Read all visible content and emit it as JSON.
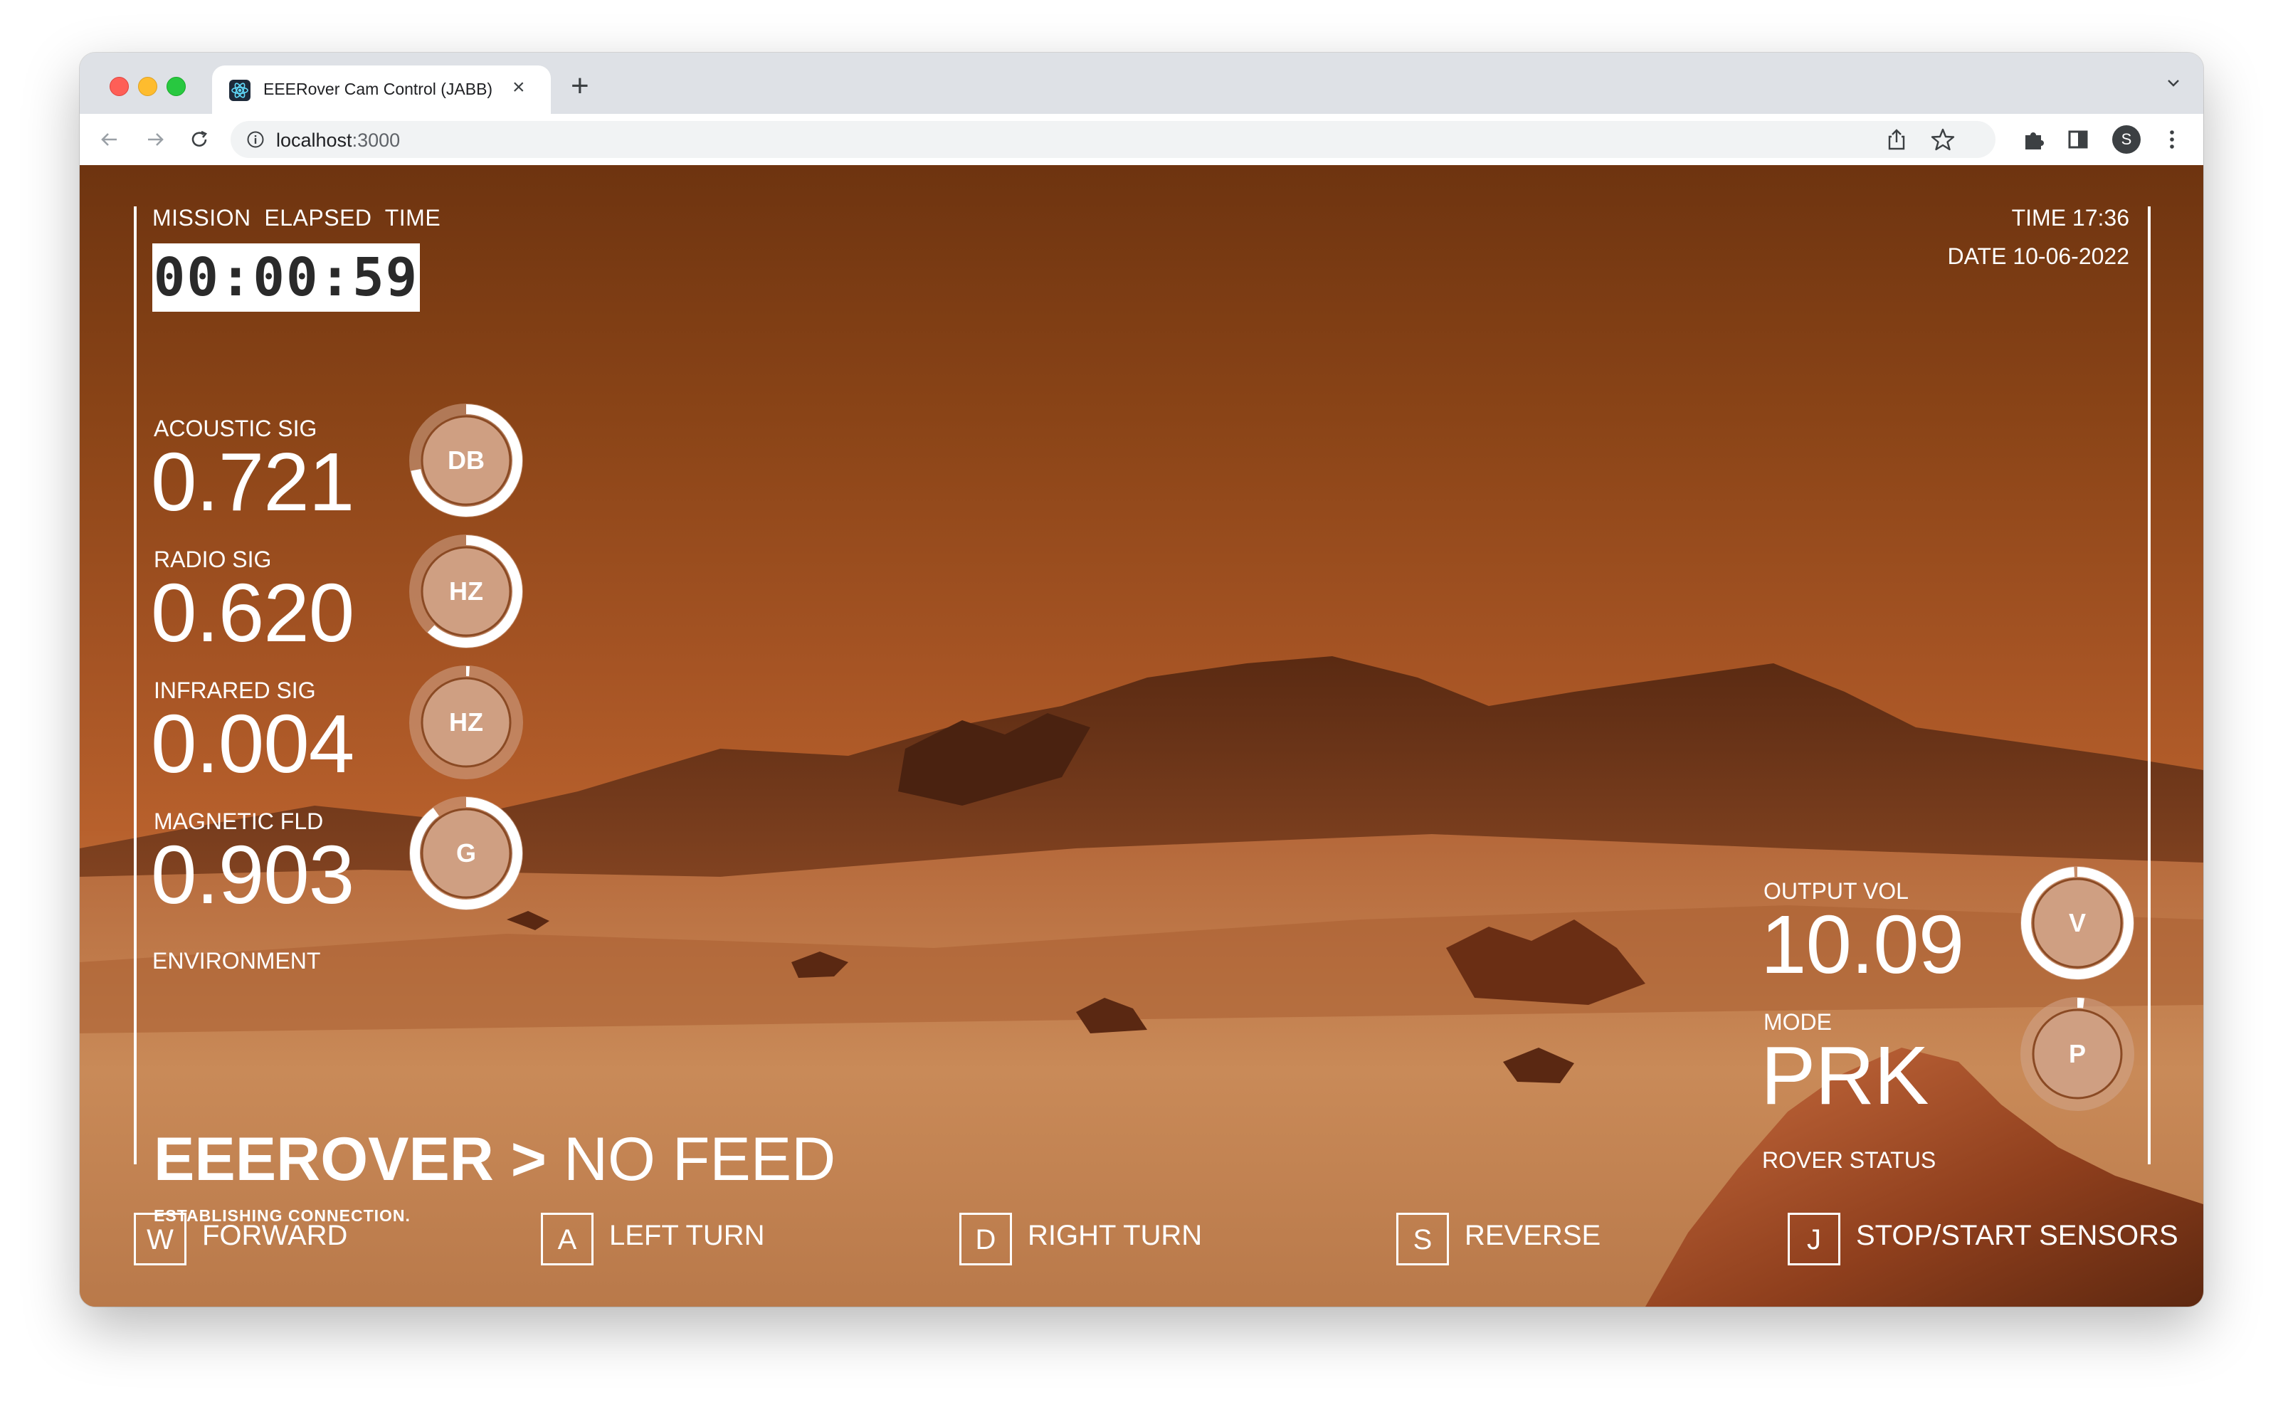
{
  "browser": {
    "tab_title": "EEERover Cam Control (JABB)",
    "tab_close": "×",
    "new_tab": "+",
    "url_host": "localhost",
    "url_port": ":3000",
    "profile_initial": "S"
  },
  "mission": {
    "label": "MISSION  ELAPSED  TIME",
    "elapsed": "00:00:59"
  },
  "clock": {
    "time": "TIME 17:36",
    "date": "DATE 10-06-2022"
  },
  "sensors": [
    {
      "label": "ACOUSTIC SIG",
      "value": "0.721",
      "unit": "DB",
      "level": 0.72
    },
    {
      "label": "RADIO SIG",
      "value": "0.620",
      "unit": "HZ",
      "level": 0.62
    },
    {
      "label": "INFRARED SIG",
      "value": "0.004",
      "unit": "HZ",
      "level": 0.01
    },
    {
      "label": "MAGNETIC FLD",
      "value": "0.903",
      "unit": "G",
      "level": 0.9
    }
  ],
  "environment_label": "ENVIRONMENT",
  "rover": {
    "output_label": "OUTPUT VOL",
    "output_value": "10.09",
    "output_unit": "V",
    "output_level": 0.99,
    "mode_label": "MODE",
    "mode_value": "PRK",
    "mode_unit": "P",
    "mode_level": 0.02,
    "status_label": "ROVER STATUS"
  },
  "feed": {
    "name": "EEEROVER >",
    "state": "NO FEED",
    "connection": "ESTABLISHING CONNECTION."
  },
  "controls": [
    {
      "key": "W",
      "label": "FORWARD"
    },
    {
      "key": "A",
      "label": "LEFT TURN"
    },
    {
      "key": "D",
      "label": "RIGHT TURN"
    },
    {
      "key": "S",
      "label": "REVERSE"
    },
    {
      "key": "J",
      "label": "STOP/START SENSORS"
    }
  ],
  "colors": {
    "accent": "#ffffff",
    "gauge_fill": "#cf9f82",
    "sky_top": "#6e3410",
    "ground": "#c47a45"
  }
}
